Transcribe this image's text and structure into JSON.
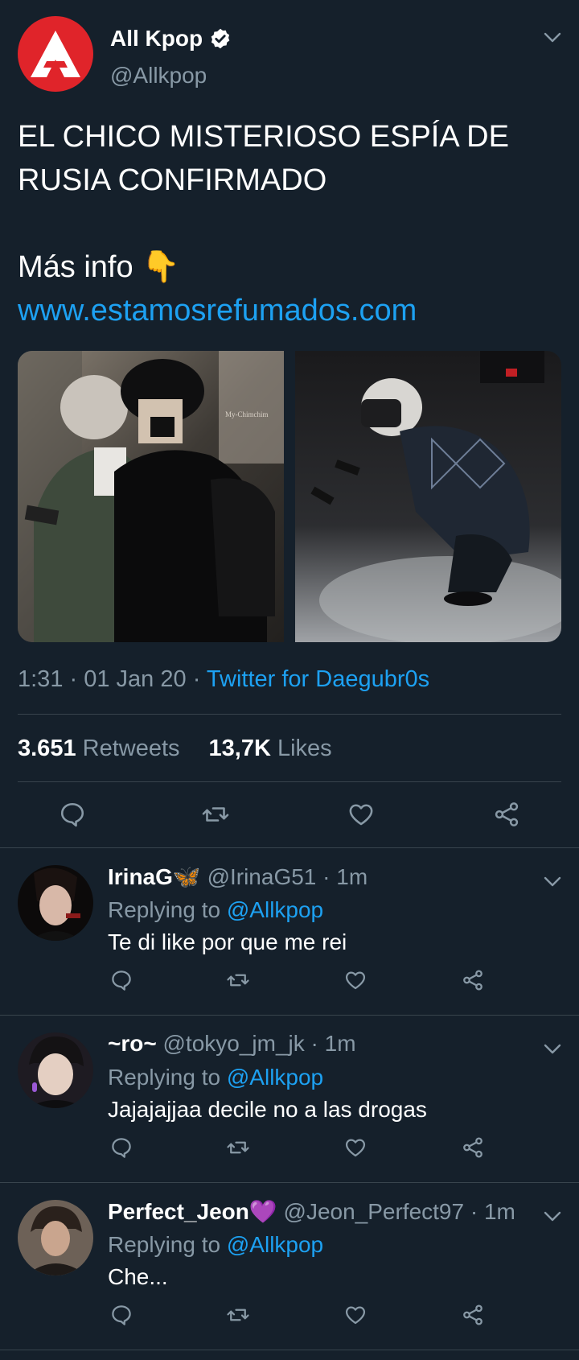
{
  "tweet": {
    "display_name": "All Kpop",
    "handle": "@Allkpop",
    "text_line1": "EL CHICO MISTERIOSO ESPÍA DE",
    "text_line2": "RUSIA CONFIRMADO",
    "more_info": "Más info 👇",
    "link": "www.estamosrefumados.com",
    "time": "1:31",
    "date": "01 Jan 20",
    "source": "Twitter for Daegubr0s",
    "retweets_count": "3.651",
    "retweets_label": "Retweets",
    "likes_count": "13,7K",
    "likes_label": "Likes",
    "avatar_color": "#e0242a"
  },
  "replies": [
    {
      "name": "IrinaG🦋",
      "handle": "@IrinaG51",
      "time": "1m",
      "replying_label": "Replying to",
      "replying_to": "@Allkpop",
      "text": "Te di like por que me rei"
    },
    {
      "name": "~ro~",
      "handle": "@tokyo_jm_jk",
      "time": "1m",
      "replying_label": "Replying to",
      "replying_to": "@Allkpop",
      "text": "Jajajajjaa decile no a las drogas"
    },
    {
      "name": "Perfect_Jeon💜",
      "handle": "@Jeon_Perfect97",
      "time": "1m",
      "replying_label": "Replying to",
      "replying_to": "@Allkpop",
      "text": "Che..."
    }
  ],
  "colors": {
    "background": "#15202b",
    "accent": "#1da1f2",
    "secondary_text": "#8899a6",
    "divider": "#38444d"
  }
}
